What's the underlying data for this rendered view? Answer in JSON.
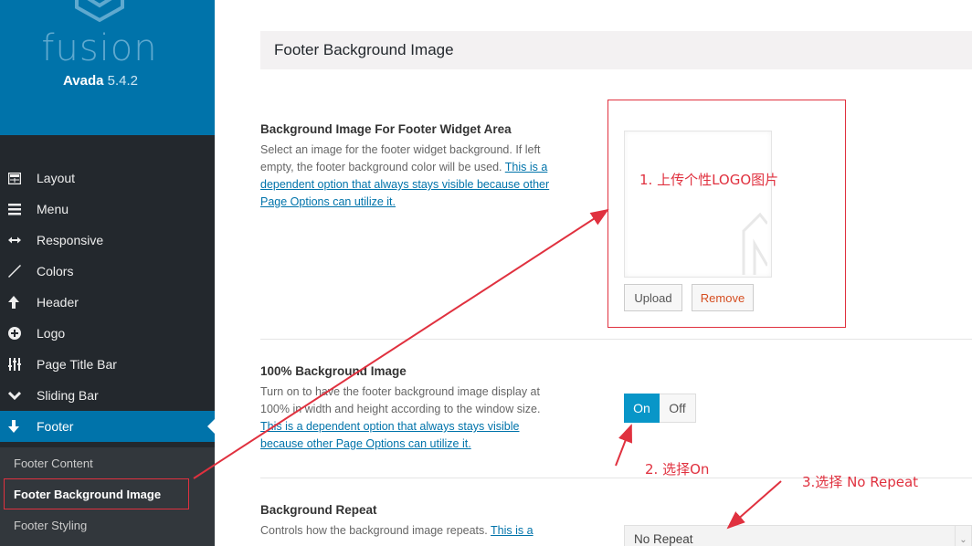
{
  "brand": {
    "logo_word": "fusion",
    "product": "Avada",
    "version": "5.4.2"
  },
  "sidebar": {
    "items": [
      {
        "label": "Layout",
        "icon": "layout-icon"
      },
      {
        "label": "Menu",
        "icon": "menu-icon"
      },
      {
        "label": "Responsive",
        "icon": "arrows-horizontal-icon"
      },
      {
        "label": "Colors",
        "icon": "brush-icon"
      },
      {
        "label": "Header",
        "icon": "arrow-up-icon"
      },
      {
        "label": "Logo",
        "icon": "plus-circle-icon"
      },
      {
        "label": "Page Title Bar",
        "icon": "sliders-icon"
      },
      {
        "label": "Sliding Bar",
        "icon": "chevron-down-icon"
      },
      {
        "label": "Footer",
        "icon": "arrow-down-icon",
        "active": true
      }
    ],
    "subitems": [
      {
        "label": "Footer Content"
      },
      {
        "label": "Footer Background Image",
        "active": true
      },
      {
        "label": "Footer Styling"
      }
    ]
  },
  "main": {
    "section_title": "Footer Background Image",
    "options": [
      {
        "title": "Background Image For Footer Widget Area",
        "desc": "Select an image for the footer widget background. If left empty, the footer background color will be used. ",
        "link": "This is a dependent option that always stays visible because other Page Options can utilize it.",
        "buttons": {
          "upload": "Upload",
          "remove": "Remove"
        }
      },
      {
        "title": "100% Background Image",
        "desc": "Turn on to have the footer background image display at 100% in width and height according to the window size. ",
        "link": "This is a dependent option that always stays visible because other Page Options can utilize it.",
        "toggle": {
          "on": "On",
          "off": "Off",
          "selected": "On"
        }
      },
      {
        "title": "Background Repeat",
        "desc": "Controls how the background image repeats. ",
        "link": "This is a",
        "select": {
          "value": "No Repeat"
        }
      }
    ]
  },
  "annotations": {
    "step1": "1. 上传个性LOGO图片",
    "step2": "2. 选择On",
    "step3": "3.选择 No Repeat",
    "color": "#e0313f"
  }
}
